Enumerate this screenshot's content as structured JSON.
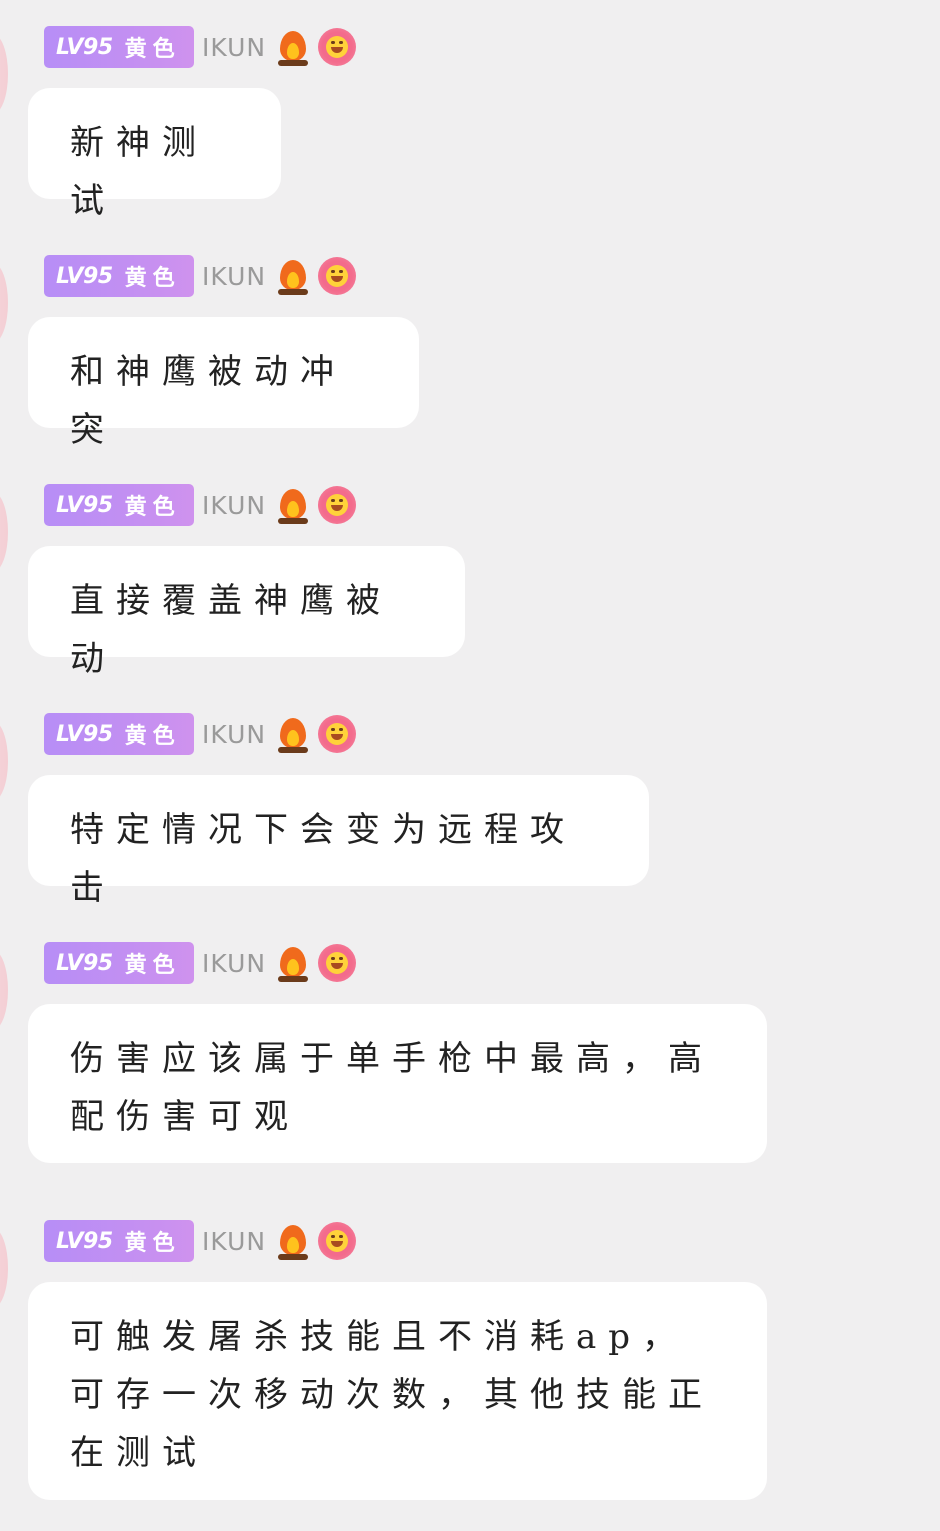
{
  "messages": [
    {
      "badge_level": "LV95",
      "badge_tag": "黄色",
      "username": "IKUN",
      "icons": [
        "fire-icon",
        "smiling-flower-icon"
      ],
      "text": "新神测试"
    },
    {
      "badge_level": "LV95",
      "badge_tag": "黄色",
      "username": "IKUN",
      "icons": [
        "fire-icon",
        "smiling-flower-icon"
      ],
      "text": "和神鹰被动冲突"
    },
    {
      "badge_level": "LV95",
      "badge_tag": "黄色",
      "username": "IKUN",
      "icons": [
        "fire-icon",
        "smiling-flower-icon"
      ],
      "text": "直接覆盖神鹰被动"
    },
    {
      "badge_level": "LV95",
      "badge_tag": "黄色",
      "username": "IKUN",
      "icons": [
        "fire-icon",
        "smiling-flower-icon"
      ],
      "text": "特定情况下会变为远程攻击"
    },
    {
      "badge_level": "LV95",
      "badge_tag": "黄色",
      "username": "IKUN",
      "icons": [
        "fire-icon",
        "smiling-flower-icon"
      ],
      "text": "伤害应该属于单手枪中最高，高配伤害可观"
    },
    {
      "badge_level": "LV95",
      "badge_tag": "黄色",
      "username": "IKUN",
      "icons": [
        "fire-icon",
        "smiling-flower-icon"
      ],
      "text": "可触发屠杀技能且不消耗ap，可存一次移动次数，其他技能正在测试"
    }
  ]
}
